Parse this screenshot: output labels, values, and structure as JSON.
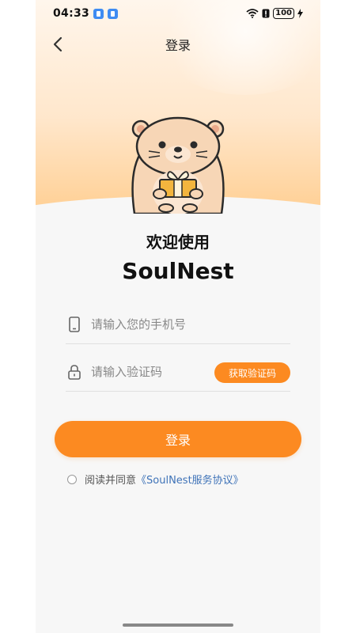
{
  "status_bar": {
    "time": "04:33",
    "battery": "100",
    "icons": [
      "app-notification-icon",
      "app-notification-icon",
      "wifi-icon",
      "alert-icon",
      "battery-icon",
      "charging-icon"
    ]
  },
  "nav": {
    "title": "登录",
    "back_icon": "chevron-left-icon"
  },
  "hero": {
    "welcome": "欢迎使用",
    "app_name": "SoulNest",
    "mascot": "otter-holding-gift"
  },
  "form": {
    "phone_placeholder": "请输入您的手机号",
    "code_placeholder": "请输入验证码",
    "get_code_label": "获取验证码",
    "login_label": "登录"
  },
  "agreement": {
    "prefix": "阅读并同意",
    "link": "《SoulNest服务协议》"
  },
  "colors": {
    "accent": "#fc8a21",
    "link": "#3f73b8",
    "background": "#f7f7f7"
  }
}
